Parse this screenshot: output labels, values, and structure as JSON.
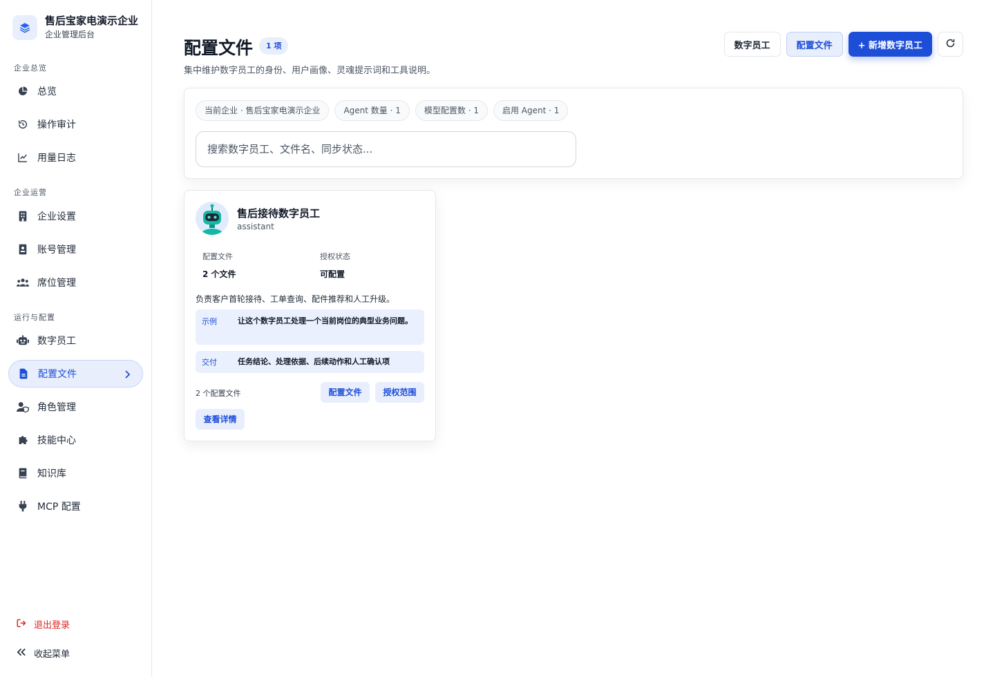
{
  "brand": {
    "name": "售后宝家电演示企业",
    "subtitle": "企业管理后台"
  },
  "sidebar": {
    "sections": [
      {
        "label": "企业总览"
      },
      {
        "label": "企业运营"
      },
      {
        "label": "运行与配置"
      }
    ],
    "items": [
      {
        "label": "总览",
        "icon": "pie-chart-icon"
      },
      {
        "label": "操作审计",
        "icon": "history-icon"
      },
      {
        "label": "用量日志",
        "icon": "line-chart-icon"
      },
      {
        "label": "企业设置",
        "icon": "building-icon"
      },
      {
        "label": "账号管理",
        "icon": "id-card-icon"
      },
      {
        "label": "席位管理",
        "icon": "users-icon"
      },
      {
        "label": "数字员工",
        "icon": "robot-icon"
      },
      {
        "label": "配置文件",
        "icon": "file-icon",
        "active": true
      },
      {
        "label": "角色管理",
        "icon": "user-shield-icon"
      },
      {
        "label": "技能中心",
        "icon": "puzzle-icon"
      },
      {
        "label": "知识库",
        "icon": "book-icon"
      },
      {
        "label": "MCP 配置",
        "icon": "plug-icon"
      }
    ],
    "logout_label": "退出登录",
    "collapse_label": "收起菜单"
  },
  "header": {
    "title": "配置文件",
    "count_badge": "1 项",
    "description": "集中维护数字员工的身份、用户画像、灵魂提示词和工具说明。",
    "actions": {
      "digital_staff": "数字员工",
      "config_files": "配置文件",
      "add_staff": "+ 新增数字员工"
    }
  },
  "filters": {
    "chips": [
      "当前企业 · 售后宝家电演示企业",
      "Agent 数量 · 1",
      "模型配置数 · 1",
      "启用 Agent · 1"
    ],
    "search_placeholder": "搜索数字员工、文件名、同步状态..."
  },
  "cards": [
    {
      "title": "售后接待数字员工",
      "subtitle": "assistant",
      "meta": [
        {
          "key": "配置文件",
          "value": "2 个文件"
        },
        {
          "key": "授权状态",
          "value": "可配置"
        }
      ],
      "description": "负责客户首轮接待、工单查询、配件推荐和人工升级。",
      "example_label": "示例",
      "example_text": "让这个数字员工处理一个当前岗位的典型业务问题。",
      "deliver_label": "交付",
      "deliver_text": "任务结论、处理依据、后续动作和人工确认项",
      "files_count": "2 个配置文件",
      "btn_config": "配置文件",
      "btn_scope": "授权范围",
      "btn_detail": "查看详情"
    }
  ],
  "colors": {
    "accent": "#1d4ed8",
    "accent_soft": "#e8eefc",
    "danger": "#dc2626"
  }
}
